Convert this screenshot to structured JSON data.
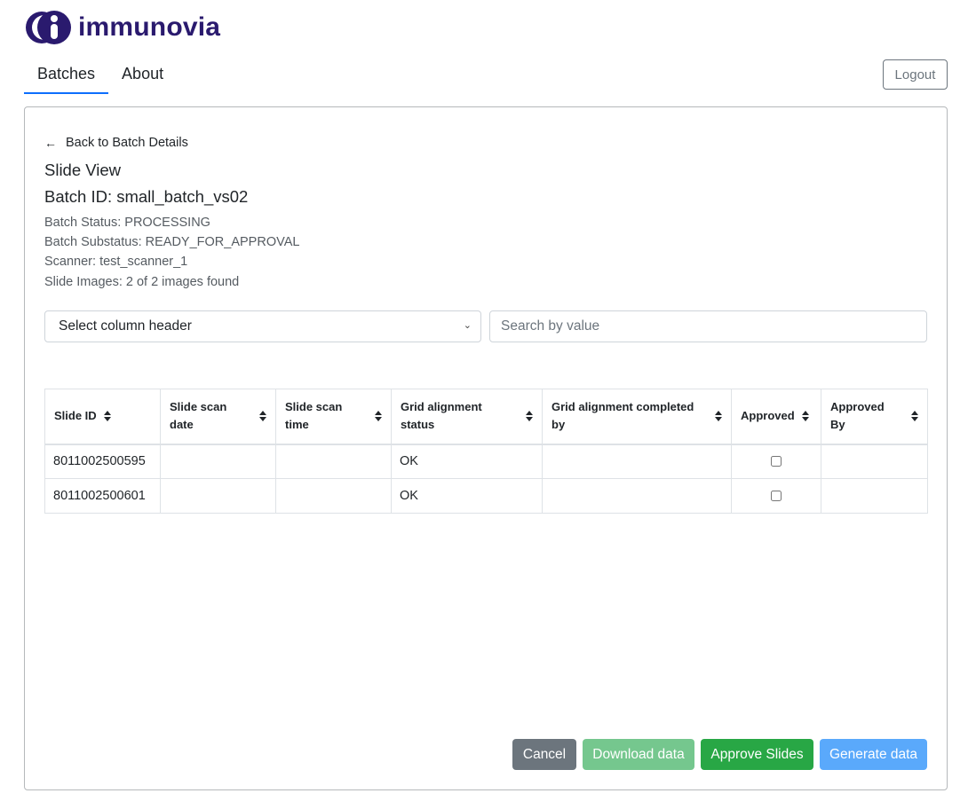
{
  "brand": {
    "name": "immunovia",
    "logo_icon": "immunovia-logo-icon",
    "color": "#2a1a6e"
  },
  "nav": {
    "tabs": [
      {
        "label": "Batches",
        "active": true
      },
      {
        "label": "About",
        "active": false
      }
    ],
    "logout_label": "Logout"
  },
  "page": {
    "back_link": {
      "icon": "arrow-left-icon",
      "label": "Back to Batch Details"
    },
    "title": "Slide View",
    "batch_id": "Batch ID: small_batch_vs02",
    "info": [
      "Batch Status: PROCESSING",
      "Batch Substatus: READY_FOR_APPROVAL",
      "Scanner: test_scanner_1",
      "Slide Images: 2 of 2 images found"
    ]
  },
  "filters": {
    "column_select": {
      "selected": "Select column header",
      "icon": "chevron-down-icon"
    },
    "search": {
      "value": "",
      "placeholder": "Search by value"
    }
  },
  "table": {
    "columns": [
      "Slide ID",
      "Slide scan date",
      "Slide scan time",
      "Grid alignment status",
      "Grid alignment completed by",
      "Approved",
      "Approved By"
    ],
    "rows": [
      {
        "slide_id": "8011002500595",
        "scan_date": "",
        "scan_time": "",
        "grid_status": "OK",
        "grid_completed_by": "",
        "approved": false,
        "approved_by": ""
      },
      {
        "slide_id": "8011002500601",
        "scan_date": "",
        "scan_time": "",
        "grid_status": "OK",
        "grid_completed_by": "",
        "approved": false,
        "approved_by": ""
      }
    ]
  },
  "actions": {
    "cancel": "Cancel",
    "download": "Download data",
    "approve": "Approve Slides",
    "generate": "Generate data"
  },
  "colors": {
    "primary": "#0d6efd",
    "secondary": "#6c757d",
    "success": "#28a745",
    "success_disabled": "#75c78e",
    "primary_disabled": "#5aa9fb"
  }
}
